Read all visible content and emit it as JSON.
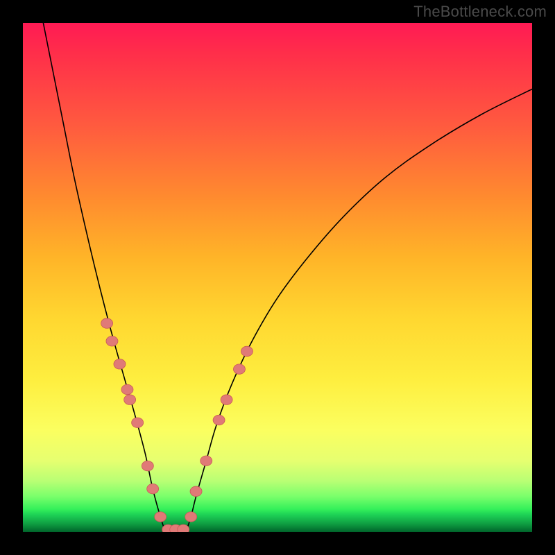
{
  "watermark_text": "TheBottleneck.com",
  "chart_data": {
    "type": "line",
    "title": "",
    "xlabel": "",
    "ylabel": "",
    "xlim": [
      0,
      100
    ],
    "ylim": [
      0,
      100
    ],
    "grid": false,
    "legend": false,
    "background_gradient_desc": "vertical: red (top) → yellow (mid) → green (bottom)",
    "series": [
      {
        "name": "left-branch",
        "x": [
          4,
          6,
          8,
          10,
          12,
          14,
          16,
          18,
          20,
          22,
          24,
          25.5,
          27,
          28
        ],
        "y": [
          100,
          90,
          80,
          70,
          61,
          52.5,
          44.5,
          37,
          30,
          23,
          15.5,
          8.5,
          3,
          0
        ]
      },
      {
        "name": "right-branch",
        "x": [
          32,
          33,
          34,
          36,
          38,
          41,
          45,
          50,
          56,
          63,
          71,
          80,
          90,
          100
        ],
        "y": [
          0,
          3,
          7,
          14,
          21,
          29,
          37.5,
          46,
          54,
          62,
          69.5,
          76,
          82,
          87
        ]
      }
    ],
    "floor_segment": {
      "x": [
        28,
        32
      ],
      "y": [
        0,
        0
      ]
    },
    "sample_points": [
      {
        "x": 16.5,
        "y": 41
      },
      {
        "x": 17.5,
        "y": 37.5
      },
      {
        "x": 19.0,
        "y": 33
      },
      {
        "x": 20.5,
        "y": 28
      },
      {
        "x": 21.0,
        "y": 26
      },
      {
        "x": 22.5,
        "y": 21.5
      },
      {
        "x": 24.5,
        "y": 13
      },
      {
        "x": 25.5,
        "y": 8.5
      },
      {
        "x": 27.0,
        "y": 3
      },
      {
        "x": 28.5,
        "y": 0.5
      },
      {
        "x": 30.0,
        "y": 0.5
      },
      {
        "x": 31.5,
        "y": 0.5
      },
      {
        "x": 33.0,
        "y": 3
      },
      {
        "x": 34.0,
        "y": 8
      },
      {
        "x": 36.0,
        "y": 14
      },
      {
        "x": 38.5,
        "y": 22
      },
      {
        "x": 40.0,
        "y": 26
      },
      {
        "x": 42.5,
        "y": 32
      },
      {
        "x": 44.0,
        "y": 35.5
      }
    ],
    "axis_ticks": {
      "x": [],
      "y": []
    },
    "annotations": []
  }
}
